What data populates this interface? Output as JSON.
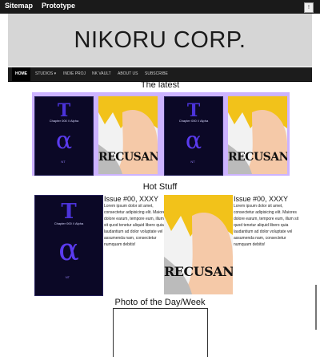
{
  "topbar": {
    "sitemap": "Sitemap",
    "prototype": "Prototype",
    "menu_button": "!"
  },
  "hero": {
    "title": "NIKORU CORP."
  },
  "nav": {
    "items": [
      "HOME",
      "STUDIOS ▾",
      "INDIE PROJ",
      "NK VAULT",
      "ABOUT US",
      "SUBSCRIBE"
    ]
  },
  "sections": {
    "latest": "The latest",
    "hot": "Hot Stuff",
    "photo": "Photo of the Day/Week"
  },
  "covers": {
    "alpha": {
      "title_letter": "T",
      "subtitle": "Chapter 000 // Alpha",
      "greek": "α",
      "mark": "NT"
    },
    "recusant": {
      "logo": "RECUSANT"
    }
  },
  "hot": {
    "left": {
      "heading": "Issue #00, XXXY",
      "text": "Lorem ipsum dolor sit amet, consectetur adipisicing elit. Maiores dolore earum, tempore eum, illum sit quod tenetur aliquid libero quia laudantium ad dolor voluptate vel assumenda nam, consectetur numquam debitis!"
    },
    "right": {
      "heading": "Issue #00, XXXY",
      "text": "Lorem ipsum dolor sit amet, consectetur adipisicing elit. Maiores dolore earum, tempore eum, illum sit quod tenetur aliquid libero quia laudantium ad dolor voluptate vel assumenda nam, consectetur numquam debitis!"
    }
  },
  "colors": {
    "accent": "#ccb3ff",
    "nav_bg": "#1c1c1c",
    "hero_bg": "#d6d6d6"
  }
}
